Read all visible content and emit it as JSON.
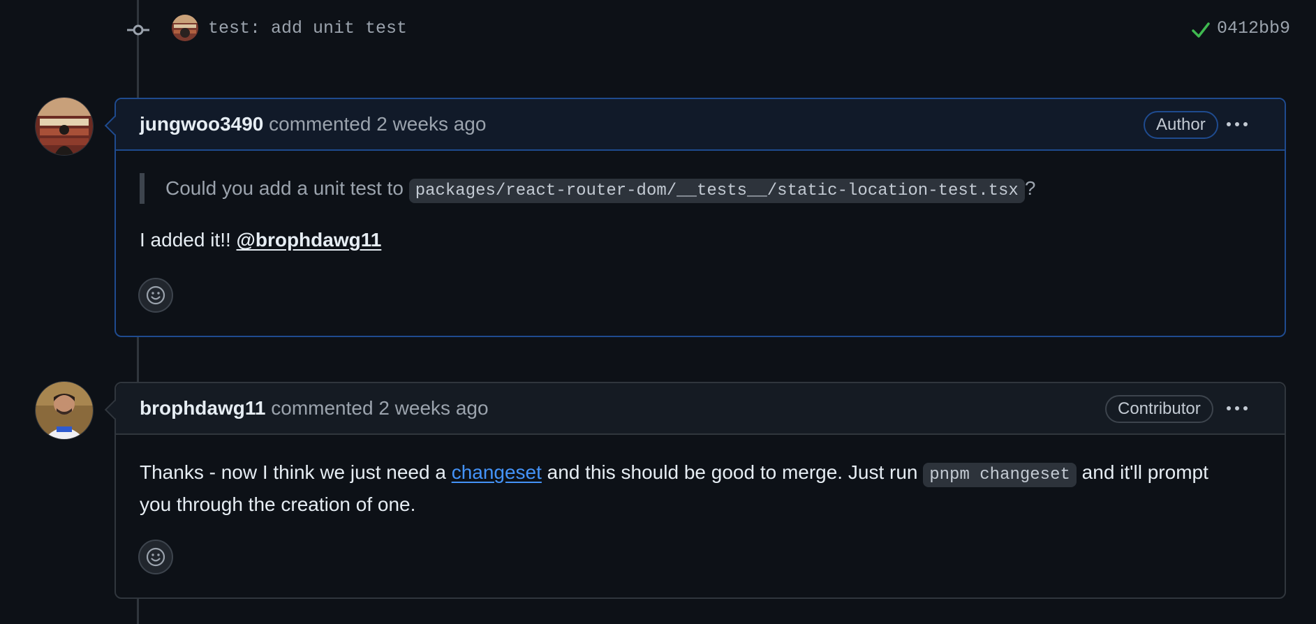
{
  "commit": {
    "message": "test: add unit test",
    "sha": "0412bb9",
    "status_icon": "check-icon",
    "status_color": "#3fb950"
  },
  "comments": [
    {
      "author": "jungwoo3490",
      "meta": "commented 2 weeks ago",
      "role": "Author",
      "quote_prefix": "Could you add a unit test to ",
      "quote_code": "packages/react-router-dom/__tests__/static-location-test.tsx",
      "quote_suffix": "?",
      "body_prefix": "I added it!! ",
      "body_mention": "@brophdawg11",
      "menu_icon": "kebab-horizontal-icon",
      "reaction_icon": "smiley-icon"
    },
    {
      "author": "brophdawg11",
      "meta": "commented 2 weeks ago",
      "role": "Contributor",
      "body_line1_prefix": "Thanks - now I think we just need a ",
      "body_link": "changeset",
      "body_line1_mid": " and this should be good to merge. Just run ",
      "body_code": "pnpm changeset",
      "body_line1_suffix": " and it'll prompt",
      "body_line2": "you through the creation of one.",
      "menu_icon": "kebab-horizontal-icon",
      "reaction_icon": "smiley-icon"
    }
  ],
  "colors": {
    "background": "#0d1117",
    "author_border": "#1f4b8f",
    "link": "#4493f8"
  }
}
